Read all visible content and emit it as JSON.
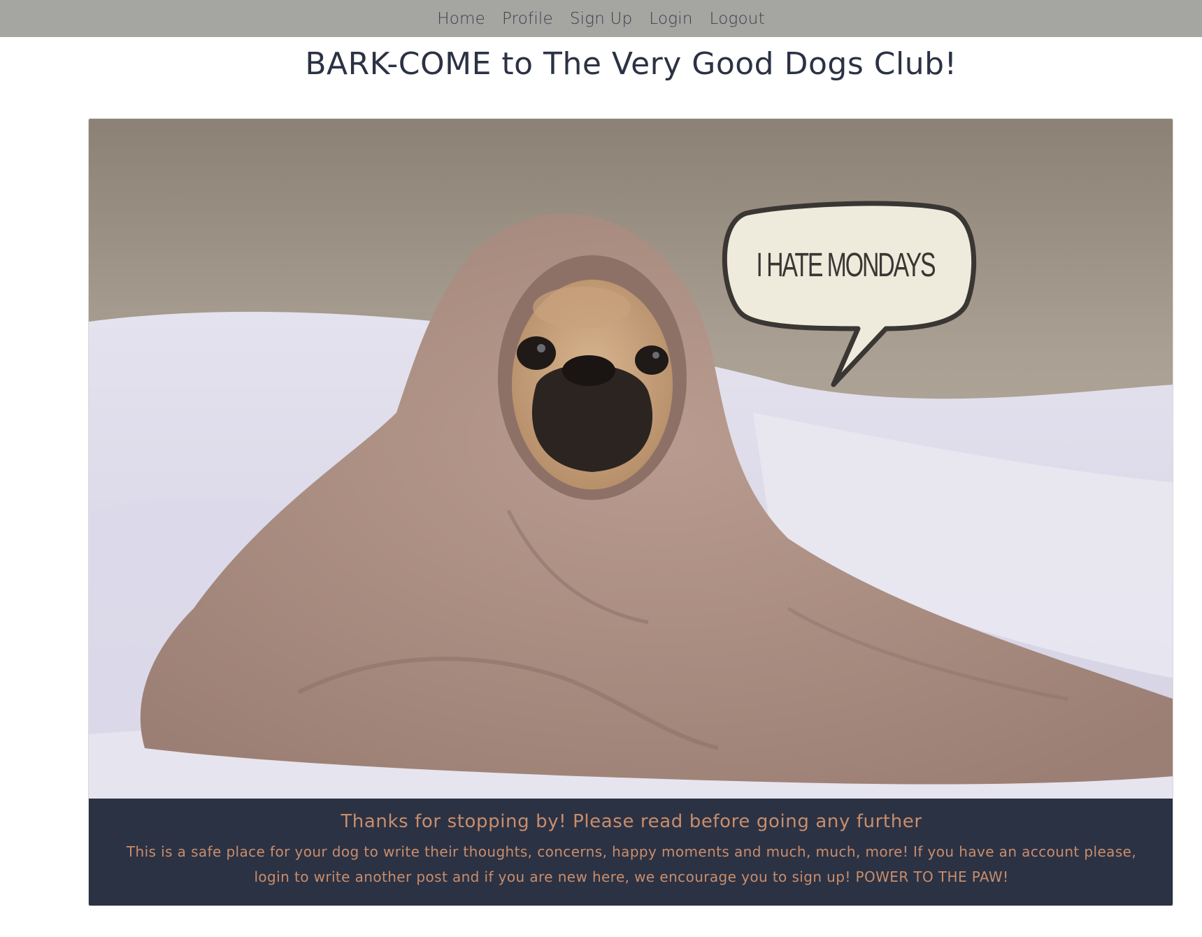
{
  "nav": {
    "items": [
      {
        "label": "Home"
      },
      {
        "label": "Profile"
      },
      {
        "label": "Sign Up"
      },
      {
        "label": "Login"
      },
      {
        "label": "Logout"
      }
    ]
  },
  "page": {
    "title": "BARK-COME to The Very Good Dogs Club!"
  },
  "hero": {
    "image_icon": "pug-in-blanket-photo",
    "speech_bubble_text": "I HATE MONDAYS"
  },
  "caption": {
    "title": "Thanks for stopping by! Please read before going any further",
    "body": "This is a safe place for your dog to write their thoughts, concerns, happy moments and much, much, more! If you have an account please, login to write another post and if you are new here, we encourage you to sign up! POWER TO THE PAW!"
  },
  "colors": {
    "navbar_bg": "#a5a5a2",
    "caption_bg": "#2b3244",
    "caption_text": "#c98d6b",
    "title_text": "#2b3244"
  }
}
